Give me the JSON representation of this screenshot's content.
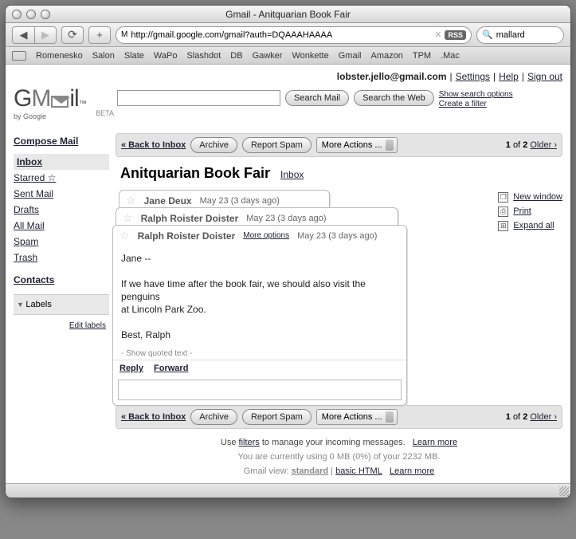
{
  "window_title": "Gmail - Anitquarian Book Fair",
  "url": "http://gmail.google.com/gmail?auth=DQAAAHAAAA",
  "rss_badge": "RSS",
  "browser_search": {
    "placeholder": "",
    "value": "mallard"
  },
  "bookmarks": [
    "Romenesko",
    "Salon",
    "Slate",
    "WaPo",
    "Slashdot",
    "DB",
    "Gawker",
    "Wonkette",
    "Gmail",
    "Amazon",
    "TPM",
    ".Mac"
  ],
  "account": {
    "email": "lobster.jello@gmail.com",
    "settings": "Settings",
    "help": "Help",
    "signout": "Sign out"
  },
  "logo": {
    "by": "by Google",
    "beta": "BETA",
    "tm": "™"
  },
  "search": {
    "search_mail": "Search Mail",
    "search_web": "Search the Web",
    "options": "Show search options",
    "filter": "Create a filter"
  },
  "sidebar": {
    "compose": "Compose Mail",
    "inbox": "Inbox",
    "starred": "Starred ☆",
    "sent": "Sent Mail",
    "drafts": "Drafts",
    "all": "All Mail",
    "spam": "Spam",
    "trash": "Trash",
    "contacts": "Contacts",
    "labels_hdr": "Labels",
    "edit_labels": "Edit labels"
  },
  "actionbar": {
    "back": "« Back to Inbox",
    "archive": "Archive",
    "spam": "Report Spam",
    "more": "More Actions ...",
    "page_prefix": "1",
    "page_of": "of",
    "page_total": "2",
    "older": "Older ›"
  },
  "thread": {
    "subject": "Anitquarian Book Fair",
    "label_link": "Inbox",
    "messages": [
      {
        "sender": "Jane Deux",
        "date": "May 23 (3 days ago)"
      },
      {
        "sender": "Ralph Roister Doister",
        "date": "May 23 (3 days ago)"
      },
      {
        "sender": "Ralph Roister Doister",
        "date": "May 23 (3 days ago)",
        "more": "More options"
      }
    ],
    "body_greeting": "Jane --",
    "body_line1": "If we have time after the book fair, we should also visit the penguins",
    "body_line2": "at Lincoln Park Zoo.",
    "body_signoff": "Best, Ralph",
    "quoted": "- Show quoted text -",
    "reply": "Reply",
    "forward": "Forward"
  },
  "sidelinks": {
    "new_window": "New window",
    "print": "Print",
    "expand": "Expand all"
  },
  "footer": {
    "tip_pre": "Use",
    "tip_link": "filters",
    "tip_post": "to manage your incoming messages.",
    "learn": "Learn more",
    "quota": "You are currently using 0 MB (0%) of your 2232 MB.",
    "view_label": "Gmail view:",
    "view_std": "standard",
    "view_basic": "basic HTML",
    "view_learn": "Learn more"
  }
}
